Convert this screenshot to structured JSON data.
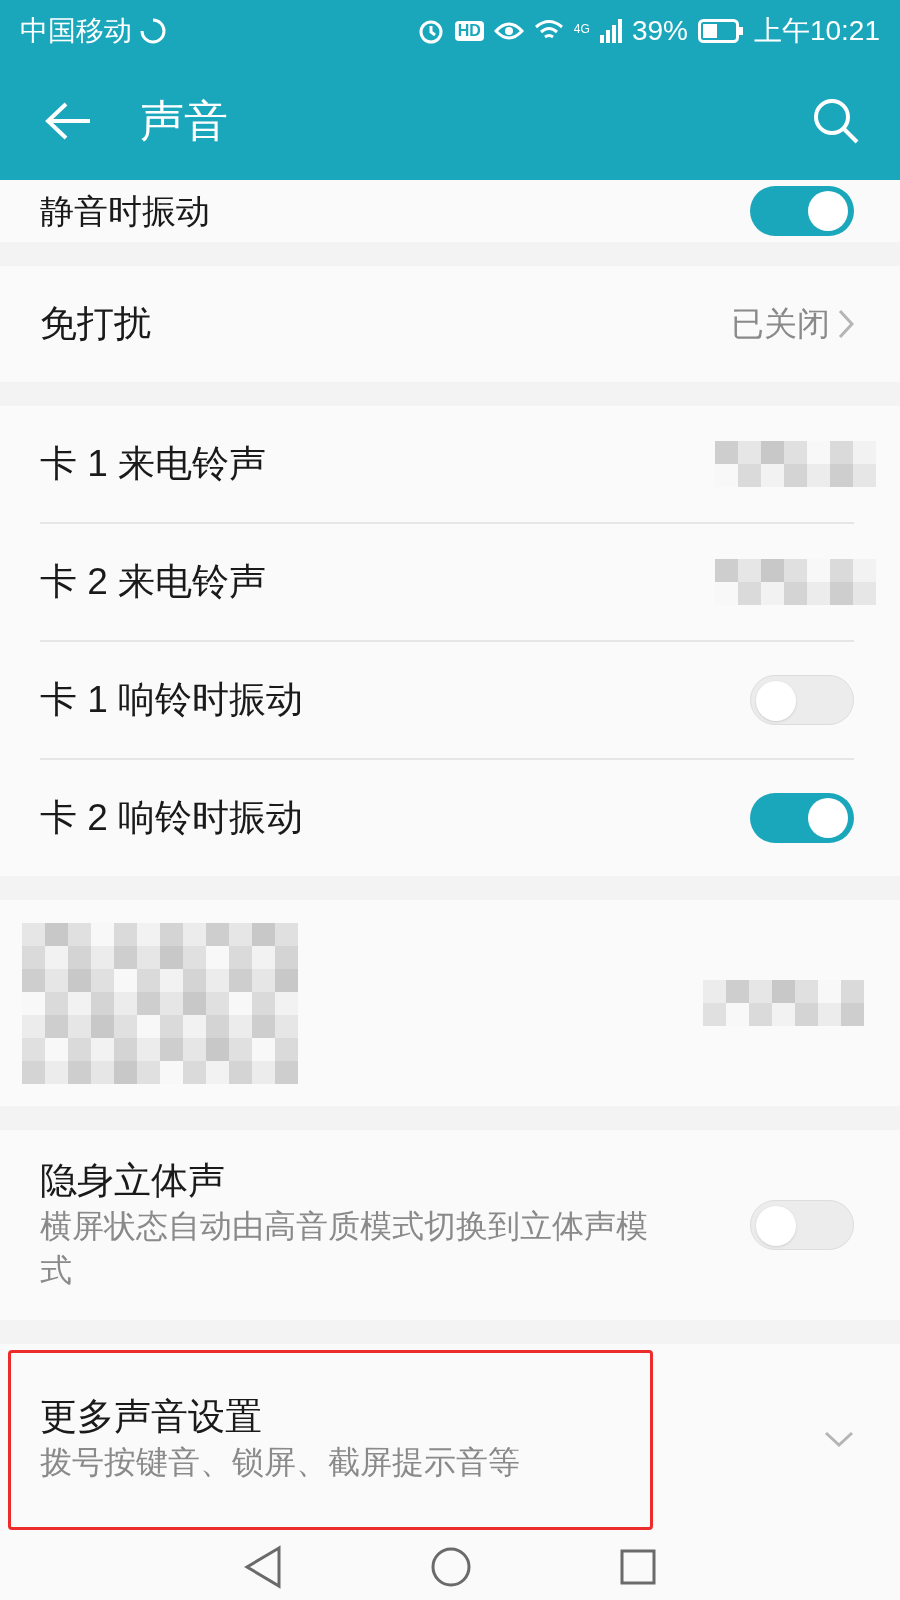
{
  "status_bar": {
    "carrier": "中国移动",
    "hd": "HD",
    "network": "4G",
    "battery": "39%",
    "time": "上午10:21"
  },
  "header": {
    "title": "声音"
  },
  "sections": [
    {
      "rows": [
        {
          "kind": "toggle",
          "label": "静音时振动",
          "on": true
        }
      ]
    },
    {
      "rows": [
        {
          "kind": "link",
          "label": "免打扰",
          "value": "已关闭"
        }
      ]
    },
    {
      "rows": [
        {
          "kind": "mosaic",
          "label": "卡 1 来电铃声"
        },
        {
          "kind": "mosaic",
          "label": "卡 2 来电铃声"
        },
        {
          "kind": "toggle",
          "label": "卡 1 响铃时振动",
          "on": false
        },
        {
          "kind": "toggle",
          "label": "卡 2 响铃时振动",
          "on": true
        }
      ]
    },
    {
      "rows": [
        {
          "kind": "redacted"
        }
      ]
    },
    {
      "rows": [
        {
          "kind": "toggle",
          "label": "隐身立体声",
          "subtitle": "横屏状态自动由高音质模式切换到立体声模式",
          "on": false
        }
      ]
    },
    {
      "rows": [
        {
          "kind": "expand",
          "label": "更多声音设置",
          "subtitle": "拨号按键音、锁屏、截屏提示音等",
          "highlighted": true
        }
      ]
    }
  ]
}
